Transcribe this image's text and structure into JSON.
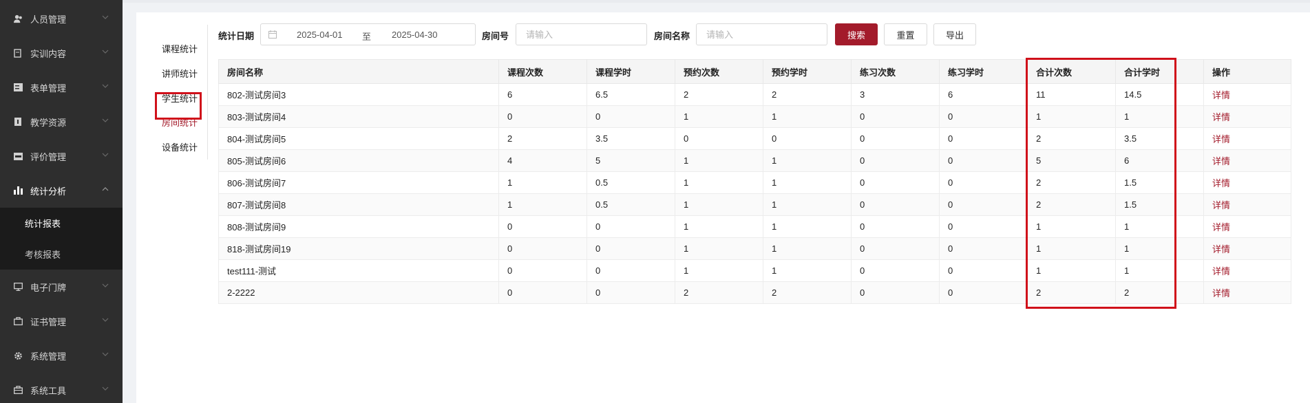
{
  "sidebar": {
    "items": [
      {
        "label": "人员管理",
        "icon": "users-icon"
      },
      {
        "label": "实训内容",
        "icon": "book-icon"
      },
      {
        "label": "表单管理",
        "icon": "form-icon"
      },
      {
        "label": "教学资源",
        "icon": "resource-icon"
      },
      {
        "label": "评价管理",
        "icon": "rating-icon"
      },
      {
        "label": "统计分析",
        "icon": "bar-chart-icon",
        "expanded": true
      },
      {
        "label": "电子门牌",
        "icon": "monitor-icon"
      },
      {
        "label": "证书管理",
        "icon": "briefcase-icon"
      },
      {
        "label": "系统管理",
        "icon": "gear-icon"
      },
      {
        "label": "系统工具",
        "icon": "toolbox-icon"
      }
    ],
    "submenu": [
      {
        "label": "统计报表",
        "active": true
      },
      {
        "label": "考核报表",
        "active": false
      }
    ]
  },
  "subnav": {
    "items": [
      "课程统计",
      "讲师统计",
      "学生统计",
      "房间统计",
      "设备统计"
    ],
    "active_index": 3
  },
  "search": {
    "date_label": "统计日期",
    "date_start": "2025-04-01",
    "date_sep": "至",
    "date_end": "2025-04-30",
    "room_no_label": "房间号",
    "room_no_placeholder": "请输入",
    "room_name_label": "房间名称",
    "room_name_placeholder": "请输入",
    "search_btn": "搜索",
    "reset_btn": "重置",
    "export_btn": "导出"
  },
  "table": {
    "headers": [
      "房间名称",
      "课程次数",
      "课程学时",
      "预约次数",
      "预约学时",
      "练习次数",
      "练习学时",
      "合计次数",
      "合计学时",
      "操作"
    ],
    "rows": [
      [
        "802-测试房间3",
        "6",
        "6.5",
        "2",
        "2",
        "3",
        "6",
        "11",
        "14.5",
        "详情"
      ],
      [
        "803-测试房间4",
        "0",
        "0",
        "1",
        "1",
        "0",
        "0",
        "1",
        "1",
        "详情"
      ],
      [
        "804-测试房间5",
        "2",
        "3.5",
        "0",
        "0",
        "0",
        "0",
        "2",
        "3.5",
        "详情"
      ],
      [
        "805-测试房间6",
        "4",
        "5",
        "1",
        "1",
        "0",
        "0",
        "5",
        "6",
        "详情"
      ],
      [
        "806-测试房间7",
        "1",
        "0.5",
        "1",
        "1",
        "0",
        "0",
        "2",
        "1.5",
        "详情"
      ],
      [
        "807-测试房间8",
        "1",
        "0.5",
        "1",
        "1",
        "0",
        "0",
        "2",
        "1.5",
        "详情"
      ],
      [
        "808-测试房间9",
        "0",
        "0",
        "1",
        "1",
        "0",
        "0",
        "1",
        "1",
        "详情"
      ],
      [
        "818-测试房间19",
        "0",
        "0",
        "1",
        "1",
        "0",
        "0",
        "1",
        "1",
        "详情"
      ],
      [
        "test111-测试",
        "0",
        "0",
        "1",
        "1",
        "0",
        "0",
        "1",
        "1",
        "详情"
      ],
      [
        "2-2222",
        "0",
        "0",
        "2",
        "2",
        "0",
        "0",
        "2",
        "2",
        "详情"
      ]
    ]
  },
  "colors": {
    "sidebar_bg": "#2e2e2e",
    "submenu_bg": "#1b1b1b",
    "accent": "#a31b2b",
    "highlight_border": "#d0101a"
  }
}
